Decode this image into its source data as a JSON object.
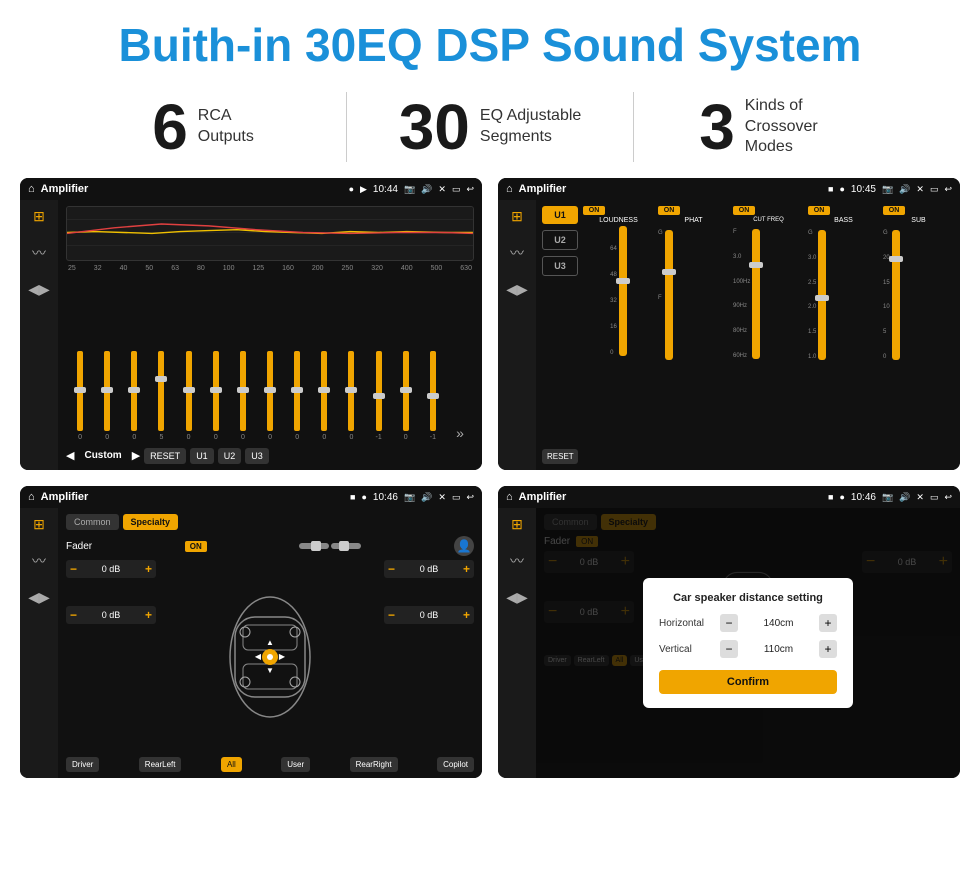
{
  "header": {
    "title": "Buith-in 30EQ DSP Sound System"
  },
  "stats": [
    {
      "number": "6",
      "text": "RCA\nOutputs"
    },
    {
      "number": "30",
      "text": "EQ Adjustable\nSegments"
    },
    {
      "number": "3",
      "text": "Kinds of\nCrossover Modes"
    }
  ],
  "screens": {
    "eq": {
      "title": "Amplifier",
      "time": "10:44",
      "freq_labels": [
        "25",
        "32",
        "40",
        "50",
        "63",
        "80",
        "100",
        "125",
        "160",
        "200",
        "250",
        "320",
        "400",
        "500",
        "630"
      ],
      "slider_values": [
        "0",
        "0",
        "0",
        "5",
        "0",
        "0",
        "0",
        "0",
        "0",
        "0",
        "0",
        "-1",
        "0",
        "-1"
      ],
      "preset": "Custom",
      "buttons": [
        "RESET",
        "U1",
        "U2",
        "U3"
      ]
    },
    "crossover": {
      "title": "Amplifier",
      "time": "10:45",
      "channels": [
        "LOUDNESS",
        "PHAT",
        "CUT FREQ",
        "BASS",
        "SUB"
      ],
      "u_buttons": [
        "U1",
        "U2",
        "U3"
      ]
    },
    "fader": {
      "title": "Amplifier",
      "time": "10:46",
      "tabs": [
        "Common",
        "Specialty"
      ],
      "fader_label": "Fader",
      "on_label": "ON",
      "controls": [
        {
          "label": "0 dB"
        },
        {
          "label": "0 dB"
        },
        {
          "label": "0 dB"
        },
        {
          "label": "0 dB"
        }
      ],
      "bottom_buttons": [
        "Driver",
        "RearLeft",
        "All",
        "User",
        "RearRight",
        "Copilot"
      ]
    },
    "distance": {
      "title": "Amplifier",
      "time": "10:46",
      "dialog": {
        "title": "Car speaker distance setting",
        "horizontal_label": "Horizontal",
        "horizontal_value": "140cm",
        "vertical_label": "Vertical",
        "vertical_value": "110cm",
        "confirm_label": "Confirm"
      },
      "bottom_buttons": [
        "Driver",
        "RearLeft",
        "All",
        "User",
        "RearRight",
        "Copilot"
      ]
    }
  }
}
